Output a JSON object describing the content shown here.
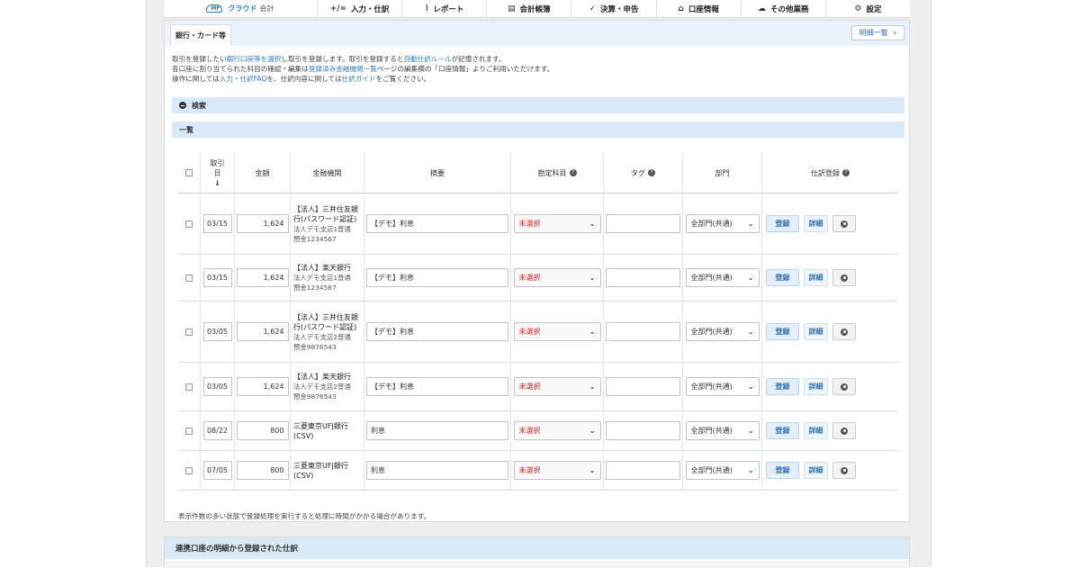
{
  "nav": {
    "logo_mark": "MF",
    "logo_text": "クラウド",
    "logo_sub": "会計",
    "items": [
      {
        "icon": "+/=",
        "label": "入力・仕訳"
      },
      {
        "icon": "📈",
        "label": "レポート"
      },
      {
        "icon": "▤",
        "label": "会計帳簿"
      },
      {
        "icon": "✓",
        "label": "決算・申告"
      },
      {
        "icon": "⌂",
        "label": "口座情報"
      },
      {
        "icon": "☁",
        "label": "その他業務"
      },
      {
        "icon": "⚙",
        "label": "設定"
      }
    ]
  },
  "tab": {
    "label": "銀行・カード等"
  },
  "statements_button": {
    "label": "明細一覧",
    "icon": "›"
  },
  "info": {
    "line1_a": "取引を登録したい",
    "line1_link1": "銀行口座等を選択",
    "line1_b": "し取引を登録します。取引を登録すると",
    "line1_link2": "自動仕訳ルール",
    "line1_c": "が記憶されます。",
    "line2_a": "各口座に割り当てられた科目の確認・編集は",
    "line2_link": "登録済み金融機関一覧",
    "line2_b": "ページの編集欄の「口座情報」よりご利用いただけます。",
    "line3_a": "操作に関しては",
    "line3_link1": "入力・仕訳FAQ",
    "line3_b": "を、仕訳内容に関しては",
    "line3_link2": "仕訳ガイド",
    "line3_c": "をご覧ください。"
  },
  "search_bar": {
    "label": "検索"
  },
  "list_bar": {
    "label": "一覧"
  },
  "table": {
    "headers": {
      "date": "取引日",
      "date_sort": "↓",
      "amount": "金額",
      "bank": "金融機関",
      "summary": "摘要",
      "account": "勘定科目",
      "tag": "タグ",
      "dept": "部門",
      "register": "仕訳登録"
    },
    "rows": [
      {
        "date": "03/15",
        "amount": "1,624",
        "bank": "【法人】三井住友銀行(パスワード認証)",
        "sub1": "法人デモ支店1普通",
        "sub2": "預金1234567",
        "summary": "【デモ】利息",
        "account": "未選択",
        "dept": "全部門(共通)"
      },
      {
        "date": "03/15",
        "amount": "1,624",
        "bank": "【法人】楽天銀行",
        "sub1": "法人デモ支店1普通",
        "sub2": "預金1234567",
        "summary": "【デモ】利息",
        "account": "未選択",
        "dept": "全部門(共通)"
      },
      {
        "date": "03/05",
        "amount": "1,624",
        "bank": "【法人】三井住友銀行(パスワード認証)",
        "sub1": "法人デモ支店2普通",
        "sub2": "預金9876543",
        "summary": "【デモ】利息",
        "account": "未選択",
        "dept": "全部門(共通)"
      },
      {
        "date": "03/05",
        "amount": "1,624",
        "bank": "【法人】楽天銀行",
        "sub1": "法人デモ支店2普通",
        "sub2": "預金9876543",
        "summary": "【デモ】利息",
        "account": "未選択",
        "dept": "全部門(共通)"
      },
      {
        "date": "08/22",
        "amount": "800",
        "bank": "三菱東京UFJ銀行(CSV)",
        "sub1": "",
        "sub2": "",
        "summary": "利息",
        "account": "未選択",
        "dept": "全部門(共通)"
      },
      {
        "date": "07/05",
        "amount": "800",
        "bank": "三菱東京UFJ銀行(CSV)",
        "sub1": "",
        "sub2": "",
        "summary": "利息",
        "account": "未選択",
        "dept": "全部門(共通)"
      }
    ],
    "buttons": {
      "register": "登録",
      "detail": "詳細"
    }
  },
  "note": "表示件数の多い状態で登録処理を実行すると処理に時間がかかる場合があります。",
  "linked_section": {
    "label": "連携口座の明細から登録された仕訳"
  },
  "colors": {
    "accent": "#2f7fc9",
    "bar": "#d9e9f7",
    "unselected": "#e0211c"
  }
}
